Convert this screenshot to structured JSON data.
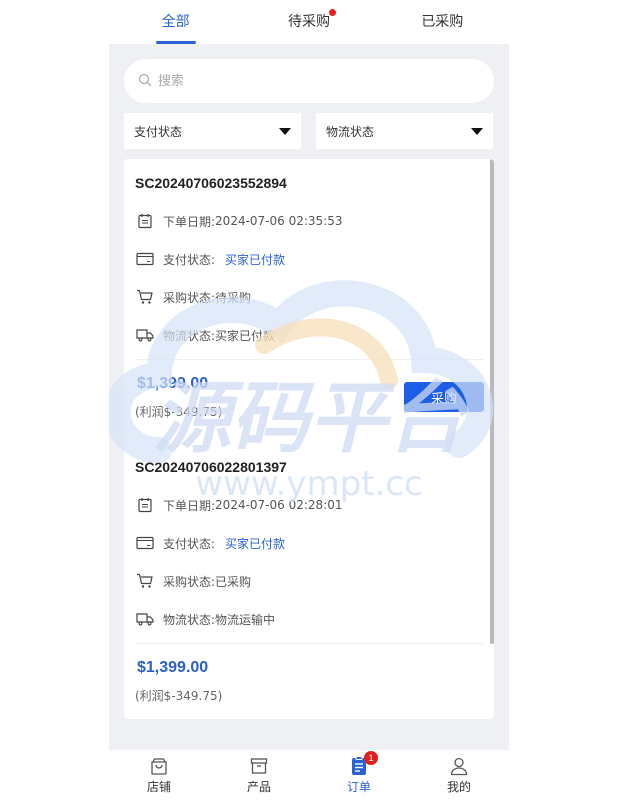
{
  "tabs": [
    {
      "label": "全部",
      "active": true
    },
    {
      "label": "待采购",
      "dot": true
    },
    {
      "label": "已采购"
    }
  ],
  "search": {
    "placeholder": "搜索"
  },
  "filters": {
    "payment": "支付状态",
    "logistics": "物流状态"
  },
  "orders": [
    {
      "id": "SC20240706023552894",
      "date_label": "下单日期:",
      "date": "2024-07-06 02:35:53",
      "pay_label": "支付状态:",
      "pay": "买家已付款",
      "purchase_label": "采购状态:",
      "purchase": "待采购",
      "logistics_label": "物流状态:",
      "logistics": "买家已付款",
      "price": "$1,399.00",
      "profit": "(利润$-349.75)",
      "button": "采购"
    },
    {
      "id": "SC20240706022801397",
      "date_label": "下单日期:",
      "date": "2024-07-06 02:28:01",
      "pay_label": "支付状态:",
      "pay": "买家已付款",
      "purchase_label": "采购状态:",
      "purchase": "已采购",
      "logistics_label": "物流状态:",
      "logistics": "物流运输中",
      "price": "$1,399.00",
      "profit": "(利润$-349.75)"
    }
  ],
  "watermark": {
    "title": "源码平台",
    "url": "www.ympt.cc"
  },
  "bottom_nav": [
    {
      "label": "店铺",
      "icon": "bag-icon"
    },
    {
      "label": "产品",
      "icon": "box-icon"
    },
    {
      "label": "订单",
      "icon": "order-icon",
      "active": true,
      "badge": "1"
    },
    {
      "label": "我的",
      "icon": "user-icon"
    }
  ],
  "colors": {
    "accent": "#2a62d1",
    "button": "#1e5ee6",
    "badge": "#e02020",
    "background": "#eef0f4"
  }
}
